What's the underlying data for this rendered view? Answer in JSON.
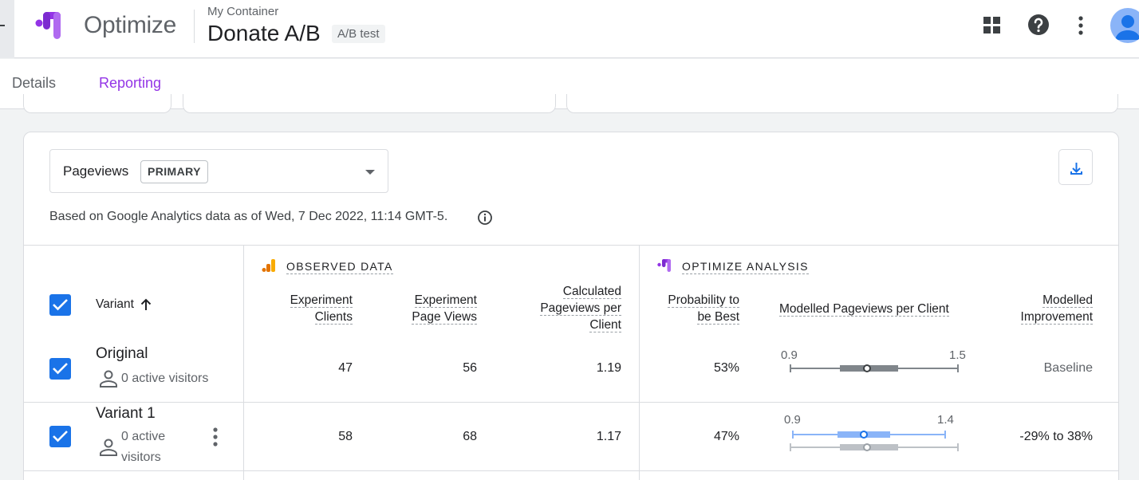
{
  "header": {
    "product_name": "Optimize",
    "container_name": "My Container",
    "experiment_name": "Donate A/B",
    "experiment_type": "A/B test",
    "icons": [
      "apps-icon",
      "help-icon",
      "more-vert-icon",
      "account-avatar"
    ]
  },
  "tabs": [
    {
      "label": "Details",
      "active": false
    },
    {
      "label": "Reporting",
      "active": true
    }
  ],
  "report": {
    "metric": {
      "label": "Pageviews",
      "badge": "PRIMARY"
    },
    "based_on": "Based on Google Analytics data as of Wed, 7 Dec 2022, 11:14 GMT-5.",
    "sections": {
      "observed": "OBSERVED DATA",
      "optimize": "OPTIMIZE ANALYSIS"
    },
    "columns": {
      "variant": "Variant",
      "experiment_clients": [
        "Experiment",
        "Clients"
      ],
      "experiment_page_views": [
        "Experiment",
        "Page Views"
      ],
      "calculated": [
        "Calculated",
        "Pageviews per",
        "Client"
      ],
      "probability": [
        "Probability to",
        "be Best"
      ],
      "modelled": "Modelled Pageviews per Client",
      "improvement": [
        "Modelled",
        "Improvement"
      ]
    },
    "rows": [
      {
        "name": "Original",
        "active_visitors": "0 active visitors",
        "clients": "47",
        "page_views": "56",
        "calculated": "1.19",
        "probability": "53%",
        "range_low": "0.9",
        "range_high": "1.5",
        "improvement": "Baseline",
        "checked": true
      },
      {
        "name": "Variant 1",
        "active_visitors_line1": "0 active",
        "active_visitors_line2": "visitors",
        "clients": "58",
        "page_views": "68",
        "calculated": "1.17",
        "probability": "47%",
        "range_low": "0.9",
        "range_high": "1.4",
        "improvement": "-29% to 38%",
        "checked": true
      }
    ]
  },
  "colors": {
    "accent_purple": "#9334e6",
    "checkbox_blue": "#1a73e8",
    "variant_bar": "#8ab4f8",
    "baseline_bar": "#9aa0a6"
  }
}
